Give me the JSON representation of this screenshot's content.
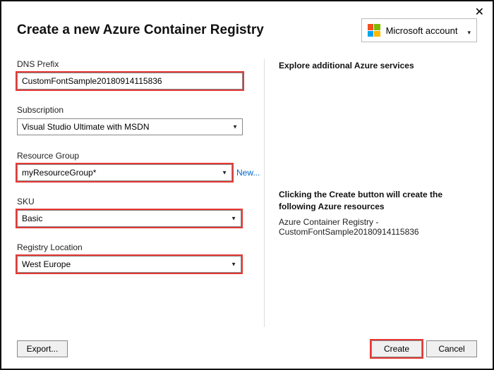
{
  "close_glyph": "✕",
  "title": "Create a new Azure Container Registry",
  "account": {
    "label": "Microsoft account"
  },
  "fields": {
    "dns": {
      "label": "DNS Prefix",
      "value": "CustomFontSample20180914115836"
    },
    "sub": {
      "label": "Subscription",
      "value": "Visual Studio Ultimate with MSDN"
    },
    "rg": {
      "label": "Resource Group",
      "value": "myResourceGroup*",
      "new_link": "New..."
    },
    "sku": {
      "label": "SKU",
      "value": "Basic"
    },
    "loc": {
      "label": "Registry Location",
      "value": "West Europe"
    }
  },
  "right": {
    "explore_title": "Explore additional Azure services",
    "create_note": "Clicking the Create button will create the following Azure resources",
    "resource_line": "Azure Container Registry - CustomFontSample20180914115836"
  },
  "buttons": {
    "export": "Export...",
    "create": "Create",
    "cancel": "Cancel"
  }
}
